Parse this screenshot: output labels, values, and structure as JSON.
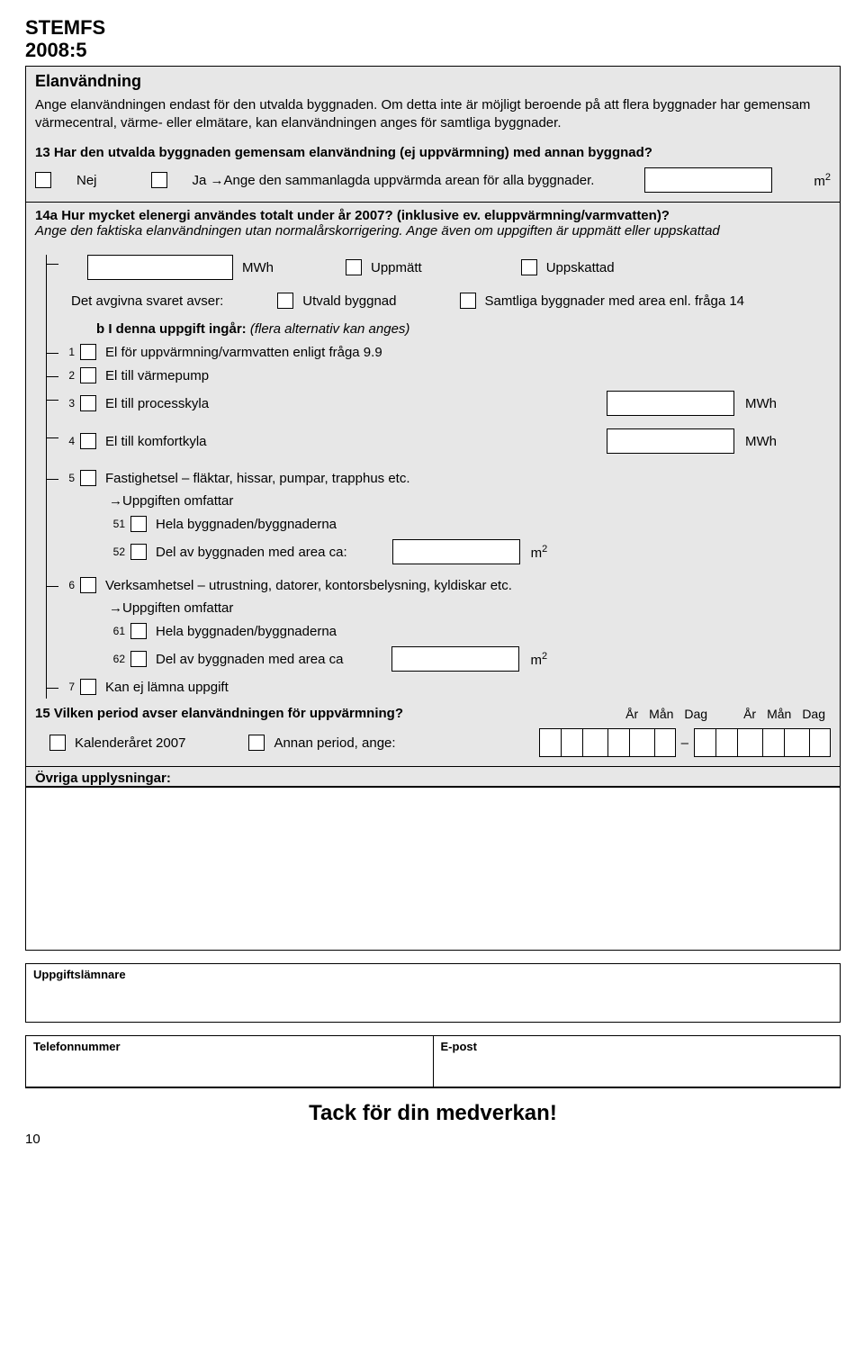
{
  "header": {
    "line1": "STEMFS",
    "line2": "2008:5"
  },
  "section_title": "Elanvändning",
  "intro_text": "Ange elanvändningen endast för den utvalda byggnaden. Om detta inte är möjligt beroende på att flera byggnader har gemensam värmecentral, värme- eller elmätare, kan elanvändningen anges för samtliga byggnader.",
  "q13": {
    "text": "13 Har den utvalda byggnaden gemensam elanvändning (ej uppvärmning) med annan byggnad?",
    "nej": "Nej",
    "ja": "Ja →Ange den sammanlagda uppvärmda arean för alla byggnader.",
    "unit": "m",
    "unit_sup": "2"
  },
  "q14a": {
    "line1": "14a Hur mycket elenergi användes totalt under år 2007? (inklusive ev. eluppvärmning/varmvatten)?",
    "line2": "Ange den faktiska elanvändningen utan normalårskorrigering. Ange även om uppgiften är uppmätt eller uppskattad",
    "mwh": "MWh",
    "uppmatt": "Uppmätt",
    "uppskattad": "Uppskattad",
    "svaret_avser": "Det avgivna svaret avser:",
    "utvald_byggnad": "Utvald byggnad",
    "samtliga": "Samtliga byggnader med area enl. fråga 14",
    "b_heading": "b I denna uppgift ingår: ",
    "b_heading_italic": "(flera alternativ kan anges)",
    "items": {
      "n1": "1",
      "t1": "El för uppvärmning/varmvatten enligt fråga 9.9",
      "n2": "2",
      "t2": "El till värmepump",
      "n3": "3",
      "t3": "El till processkyla",
      "n4": "4",
      "t4": "El till komfortkyla",
      "n5": "5",
      "t5": "Fastighetsel – fläktar, hissar, pumpar, trapphus etc.",
      "omfattar": "→Uppgiften omfattar",
      "n51": "51",
      "t51": "Hela byggnaden/byggnaderna",
      "n52": "52",
      "t52": "Del av byggnaden med area ca:",
      "n6": "6",
      "t6": "Verksamhetsel – utrustning, datorer, kontorsbelysning, kyldiskar etc.",
      "n61": "61",
      "t61": "Hela byggnaden/byggnaderna",
      "n62": "62",
      "t62": "Del av byggnaden med area ca",
      "n7": "7",
      "t7": "Kan ej lämna uppgift"
    },
    "unit_mwh": "MWh",
    "unit_m": "m",
    "unit_m_sup": "2"
  },
  "q15": {
    "text": "15 Vilken period avser elanvändningen för uppvärmning?",
    "kalender": "Kalenderåret 2007",
    "annan": "Annan period, ange:",
    "ar": "År",
    "man": "Mån",
    "dag": "Dag"
  },
  "ovriga": "Övriga upplysningar:",
  "uppgiftslamnare": "Uppgiftslämnare",
  "telefon": "Telefonnummer",
  "epost": "E-post",
  "thanks": "Tack för din medverkan!",
  "page_number": "10"
}
